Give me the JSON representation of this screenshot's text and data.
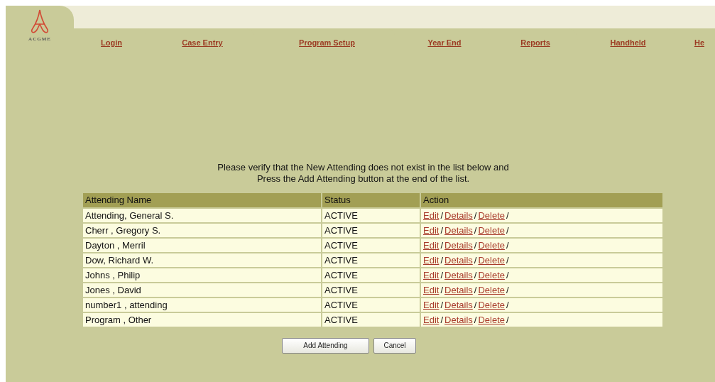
{
  "logo": {
    "text": "ACGME"
  },
  "tabs": [
    {
      "label": "Login"
    },
    {
      "label": "Case Entry"
    },
    {
      "label": "Program Setup"
    },
    {
      "label": "Year End"
    },
    {
      "label": "Reports"
    },
    {
      "label": "Handheld"
    },
    {
      "label": "He"
    }
  ],
  "instructions": [
    "Please verify that the New Attending does not exist in the list below and",
    "Press the Add Attending button at the end of the list."
  ],
  "table": {
    "columns": [
      "Attending Name",
      "Status",
      "Action"
    ],
    "rows": [
      {
        "name": "Attending, General S.",
        "status": "ACTIVE",
        "actions": [
          "Edit",
          "/",
          "Details",
          "/",
          "Delete",
          "/"
        ]
      },
      {
        "name": "Cherr , Gregory S.",
        "status": "ACTIVE",
        "actions": [
          "Edit",
          "/",
          "Details",
          "/",
          "Delete",
          "/"
        ]
      },
      {
        "name": "Dayton , Merril",
        "status": "ACTIVE",
        "actions": [
          "Edit",
          "/",
          "Details",
          "/",
          "Delete",
          "/"
        ]
      },
      {
        "name": "Dow, Richard W.",
        "status": "ACTIVE",
        "actions": [
          "Edit",
          "/",
          "Details",
          "/",
          "Delete",
          "/"
        ]
      },
      {
        "name": "Johns , Philip",
        "status": "ACTIVE",
        "actions": [
          "Edit",
          "/",
          "Details",
          "/",
          "Delete",
          "/"
        ]
      },
      {
        "name": "Jones , David",
        "status": "ACTIVE",
        "actions": [
          "Edit",
          "/",
          "Details",
          "/",
          "Delete",
          "/"
        ]
      },
      {
        "name": "number1 , attending",
        "status": "ACTIVE",
        "actions": [
          "Edit",
          "/",
          "Details",
          "/",
          "Delete",
          "/"
        ]
      },
      {
        "name": "Program , Other",
        "status": "ACTIVE",
        "actions": [
          "Edit",
          "/",
          "Details",
          "/",
          "Delete",
          "/"
        ]
      }
    ]
  },
  "buttons": [
    "Add Attending",
    "Cancel"
  ]
}
